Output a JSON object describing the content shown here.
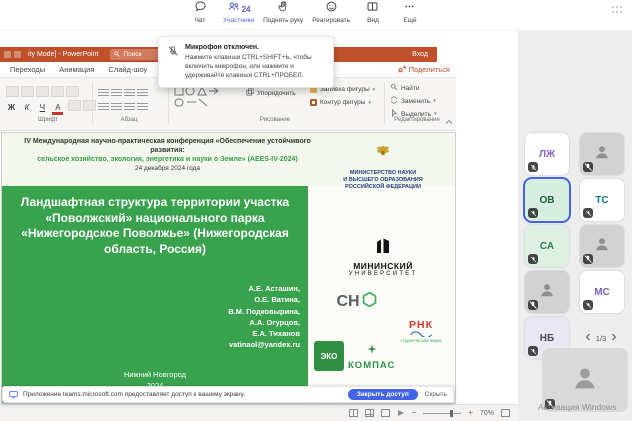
{
  "colors": {
    "teams_accent": "#5b5fc7",
    "ppt_titlebar": "#c0502a",
    "slide_green": "#38a24d",
    "banner_button": "#4262ea",
    "logo_green": "#2e8f43"
  },
  "teams_toolbar": {
    "items": [
      {
        "label": "Чат"
      },
      {
        "label": "Участники",
        "badge": "24",
        "active": true
      },
      {
        "label": "Поднять руку"
      },
      {
        "label": "Реагировать"
      },
      {
        "label": "Вид"
      },
      {
        "label": "Ещё"
      }
    ]
  },
  "mic_tooltip": {
    "title": "Микрофон отключен.",
    "body": "Нажмите клавиши CTRL+SHIFT+Ь, чтобы включить микрофон, или нажмите и удерживайте клавиши CTRL+ПРОБЕЛ."
  },
  "ppt": {
    "window_title": "ity Mode] - PowerPoint",
    "search_placeholder": "Поиск",
    "signin": "Вход",
    "tabs": [
      "Переходы",
      "Анимация",
      "Слайд-шоу"
    ],
    "share": "Поделиться",
    "font_buttons": [
      "Ж",
      "К",
      "Ч",
      "А"
    ],
    "drawing_arrange": "Упорядочить",
    "drawing_fill": "Заливка фигуры",
    "drawing_outline": "Контур фигуры",
    "editing": [
      "Найти",
      "Заменить",
      "Выделить"
    ],
    "group_labels": [
      "Шрифт",
      "Абзац",
      "Рисование",
      "Редактирование"
    ],
    "status": {
      "zoom": "70%"
    }
  },
  "slide": {
    "header1": "IV Международная научно-практическая конференция «Обеспечение устойчивого развития:",
    "header2": "сельское хозяйство, экология, энергетика и науки о Земле» (AEES-IV-2024)",
    "header3": "24 декабря 2024 года",
    "title": "Ландшафтная структура территории участка «Поволжский» национального парка «Нижегородское Поволжье» (Нижегородская область, Россия)",
    "authors": "А.Е. Асташин,\nО.Е. Ватина,\nВ.М. Подковырина,\nА.А. Огурцов,\nЕ.А. Тиханов\nvatinaol@yandex.ru",
    "footer": "Нижний Новгород\n2024",
    "ministry": "МИНИСТЕРСТВО НАУКИ\nИ ВЫСШЕГО ОБРАЗОВАНИЯ\nРОССИЙСКОЙ ФЕДЕРАЦИИ",
    "university1": "МИНИНСКИЙ",
    "university2": "УНИВЕРСИТЕТ",
    "sno": "СН",
    "rnk": "РНК",
    "rnk_caption": "студенческая наука",
    "eco1": "ЭКО",
    "eco2": "КОМПАС"
  },
  "share_banner": {
    "text": "Приложение teams.microsoft.com предоставляет доступ к вашему экрану.",
    "stop": "Закрыть доступ",
    "hide": "Скрыть"
  },
  "participants_panel": {
    "tiles": [
      {
        "initials": "ЛЖ"
      },
      {
        "avatar": true
      },
      {
        "initials": "ОВ",
        "active": true
      },
      {
        "initials": "ТС"
      },
      {
        "initials": "СА"
      },
      {
        "avatar": true
      },
      {
        "avatar": true
      },
      {
        "initials": "МС"
      },
      {
        "initials": "НБ"
      }
    ],
    "pagination": "1/3",
    "watermark": "Активация Windows"
  }
}
